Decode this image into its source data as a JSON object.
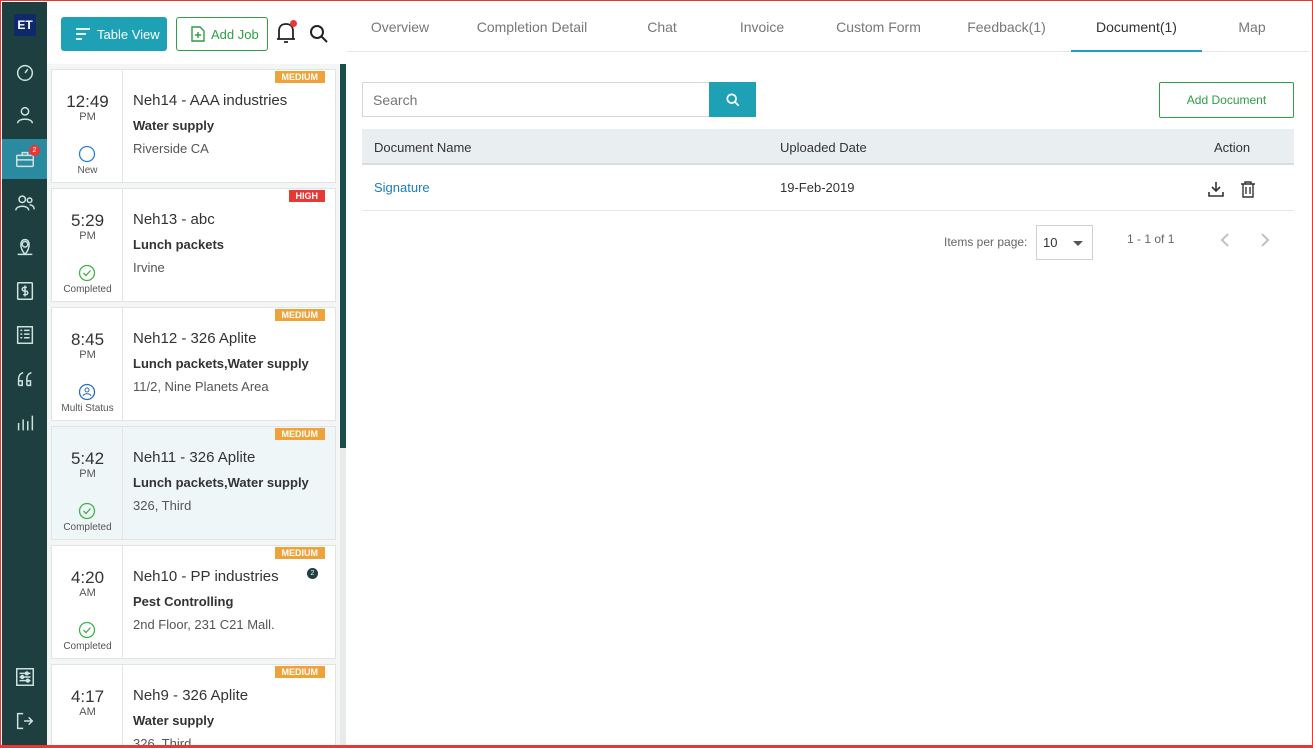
{
  "app": {
    "logo_text": "ET",
    "jobs_badge": "2"
  },
  "toolbar": {
    "table_view_label": "Table View",
    "add_job_label": "Add Job"
  },
  "jobs": [
    {
      "time": "12:49",
      "ampm": "PM",
      "status": "New",
      "title": "Neh14 - AAA industries",
      "service": "Water supply",
      "address": "Riverside CA",
      "priority": "MEDIUM"
    },
    {
      "time": "5:29",
      "ampm": "PM",
      "status": "Completed",
      "title": "Neh13 - abc",
      "service": "Lunch packets",
      "address": "Irvine",
      "priority": "HIGH"
    },
    {
      "time": "8:45",
      "ampm": "PM",
      "status": "Multi Status",
      "title": "Neh12 - 326 Aplite",
      "service": "Lunch packets,Water supply",
      "address": "11/2, Nine Planets Area",
      "priority": "MEDIUM"
    },
    {
      "time": "5:42",
      "ampm": "PM",
      "status": "Completed",
      "title": "Neh11 - 326 Aplite",
      "service": "Lunch packets,Water supply",
      "address": "326, Third",
      "priority": "MEDIUM"
    },
    {
      "time": "4:20",
      "ampm": "AM",
      "status": "Completed",
      "title": "Neh10 - PP industries",
      "service": "Pest Controlling",
      "address": "2nd Floor, 231 C21 Mall.",
      "priority": "MEDIUM",
      "badge": "2"
    },
    {
      "time": "4:17",
      "ampm": "AM",
      "status": "",
      "title": "Neh9 - 326 Aplite",
      "service": "Water supply",
      "address": "326, Third",
      "priority": "MEDIUM"
    }
  ],
  "tabs": [
    "Overview",
    "Completion Detail",
    "Chat",
    "Invoice",
    "Custom Form",
    "Feedback(1)",
    "Document(1)",
    "Map"
  ],
  "documents": {
    "search_placeholder": "Search",
    "add_label": "Add Document",
    "columns": [
      "Document Name",
      "Uploaded Date",
      "Action"
    ],
    "rows": [
      {
        "name": "Signature",
        "date": "19-Feb-2019"
      }
    ],
    "items_per_page_label": "Items per page:",
    "items_per_page": "10",
    "range": "1 - 1 of 1"
  },
  "colors": {
    "rail": "#1d3f3f",
    "accent": "#1ea0b5",
    "green": "#2e9e46",
    "medium": "#f0a23a",
    "high": "#e53935"
  }
}
